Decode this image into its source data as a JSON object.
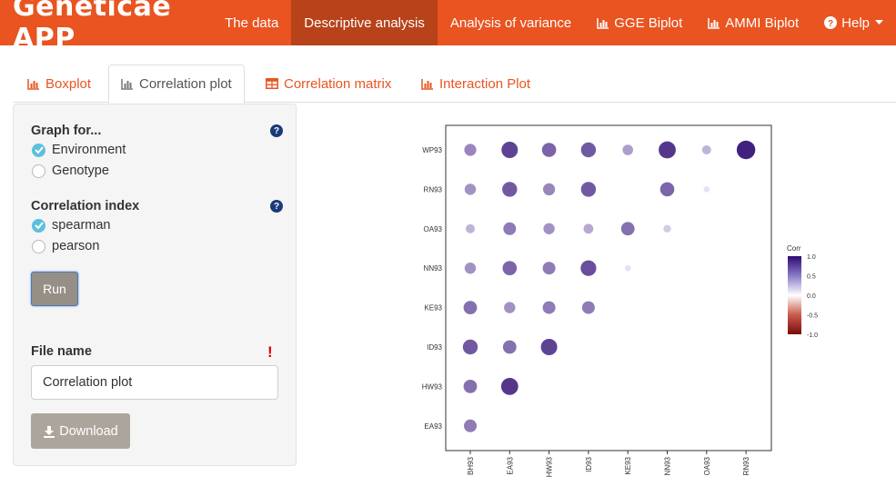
{
  "brand": "Geneticae APP",
  "colors": {
    "navbar": "#e95420",
    "navbar_active": "#b8421a",
    "accent": "#e95420",
    "radio_on": "#5bc0de",
    "help_icon": "#1a3a78"
  },
  "nav": {
    "items": [
      {
        "label": "The data",
        "icon": "",
        "active": false
      },
      {
        "label": "Descriptive analysis",
        "icon": "",
        "active": true
      },
      {
        "label": "Analysis of variance",
        "icon": "",
        "active": false
      },
      {
        "label": "GGE Biplot",
        "icon": "bar-chart-icon",
        "active": false
      },
      {
        "label": "AMMI Biplot",
        "icon": "bar-chart-icon",
        "active": false
      },
      {
        "label": "Help",
        "icon": "question-circle-icon",
        "active": false
      }
    ]
  },
  "tabs": [
    {
      "label": "Boxplot",
      "icon": "bar-chart-icon",
      "active": false
    },
    {
      "label": "Correlation plot",
      "icon": "bar-chart-icon",
      "active": true
    },
    {
      "label": "Correlation matrix",
      "icon": "table-icon",
      "active": false
    },
    {
      "label": "Interaction Plot",
      "icon": "bar-chart-icon",
      "active": false
    }
  ],
  "sidebar": {
    "graph_for_label": "Graph for...",
    "graph_for_options": [
      {
        "label": "Environment",
        "selected": true
      },
      {
        "label": "Genotype",
        "selected": false
      }
    ],
    "corr_index_label": "Correlation index",
    "corr_index_options": [
      {
        "label": "spearman",
        "selected": true
      },
      {
        "label": "pearson",
        "selected": false
      }
    ],
    "run_label": "Run",
    "file_name_label": "File name",
    "file_name_required": "!",
    "file_name_value": "Correlation plot",
    "download_label": "Download",
    "help_glyph": "?"
  },
  "chart_data": {
    "type": "heatmap",
    "rows": [
      "WP93",
      "RN93",
      "OA93",
      "NN93",
      "KE93",
      "ID93",
      "HW93",
      "EA93"
    ],
    "cols": [
      "BH93",
      "EA93",
      "HW93",
      "ID93",
      "KE93",
      "NN93",
      "OA93",
      "RN93"
    ],
    "values": [
      [
        0.45,
        0.75,
        0.6,
        0.65,
        0.35,
        0.8,
        0.25,
        0.9
      ],
      [
        0.4,
        0.65,
        0.45,
        0.65,
        null,
        0.6,
        0.05,
        null
      ],
      [
        0.25,
        0.5,
        0.4,
        0.3,
        0.55,
        0.15,
        null,
        null
      ],
      [
        0.4,
        0.6,
        0.5,
        0.7,
        0.05,
        null,
        null,
        null
      ],
      [
        0.55,
        0.4,
        0.5,
        0.5,
        null,
        null,
        null,
        null
      ],
      [
        0.65,
        0.55,
        0.75,
        null,
        null,
        null,
        null,
        null
      ],
      [
        0.55,
        0.8,
        null,
        null,
        null,
        null,
        null,
        null
      ],
      [
        0.5,
        null,
        null,
        null,
        null,
        null,
        null,
        null
      ]
    ],
    "legend_title": "Corr",
    "legend_ticks": [
      "1.0",
      "0.5",
      "0.0",
      "-0.5",
      "-1.0"
    ],
    "range": [
      -1,
      1
    ],
    "legend_position": "right",
    "grid": false
  }
}
